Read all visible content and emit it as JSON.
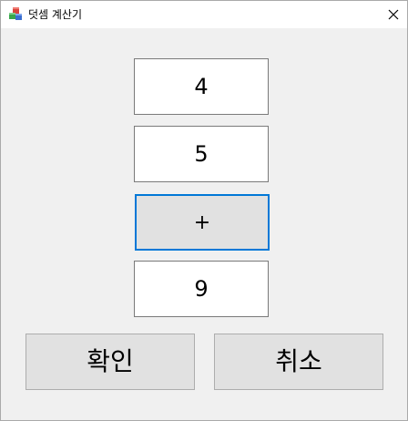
{
  "window": {
    "title": "덧셈 계산기",
    "app_icon": "cubes-icon",
    "close_icon": "close-icon"
  },
  "calculator": {
    "operand1": "4",
    "operand2": "5",
    "operator_label": "+",
    "result": "9"
  },
  "buttons": {
    "confirm_label": "확인",
    "cancel_label": "취소"
  },
  "colors": {
    "focus_border": "#0078d7",
    "button_face": "#e1e1e1",
    "window_bg": "#f0f0f0"
  }
}
